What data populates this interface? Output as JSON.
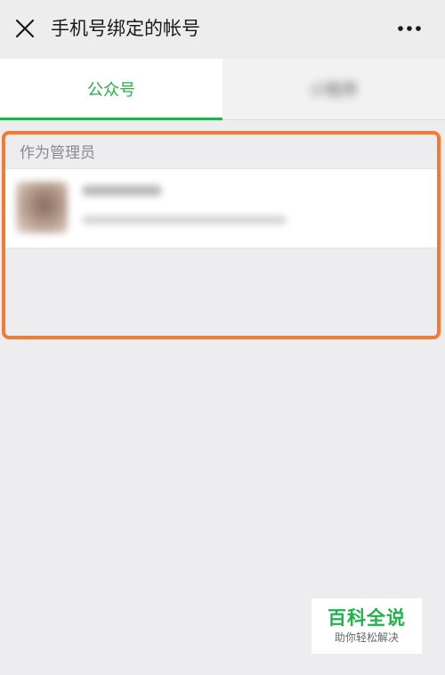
{
  "header": {
    "title": "手机号绑定的帐号",
    "close_icon": "close-icon",
    "more_icon": "more-icon"
  },
  "tabs": [
    {
      "label": "公众号",
      "active": true
    },
    {
      "label": "小程序",
      "active": false,
      "blurred": true
    }
  ],
  "section": {
    "label": "作为管理员",
    "highlight_color": "#f47a34"
  },
  "accent_color": "#22b14c",
  "watermark": {
    "title": "百科全说",
    "subtitle": "助你轻松解决"
  }
}
